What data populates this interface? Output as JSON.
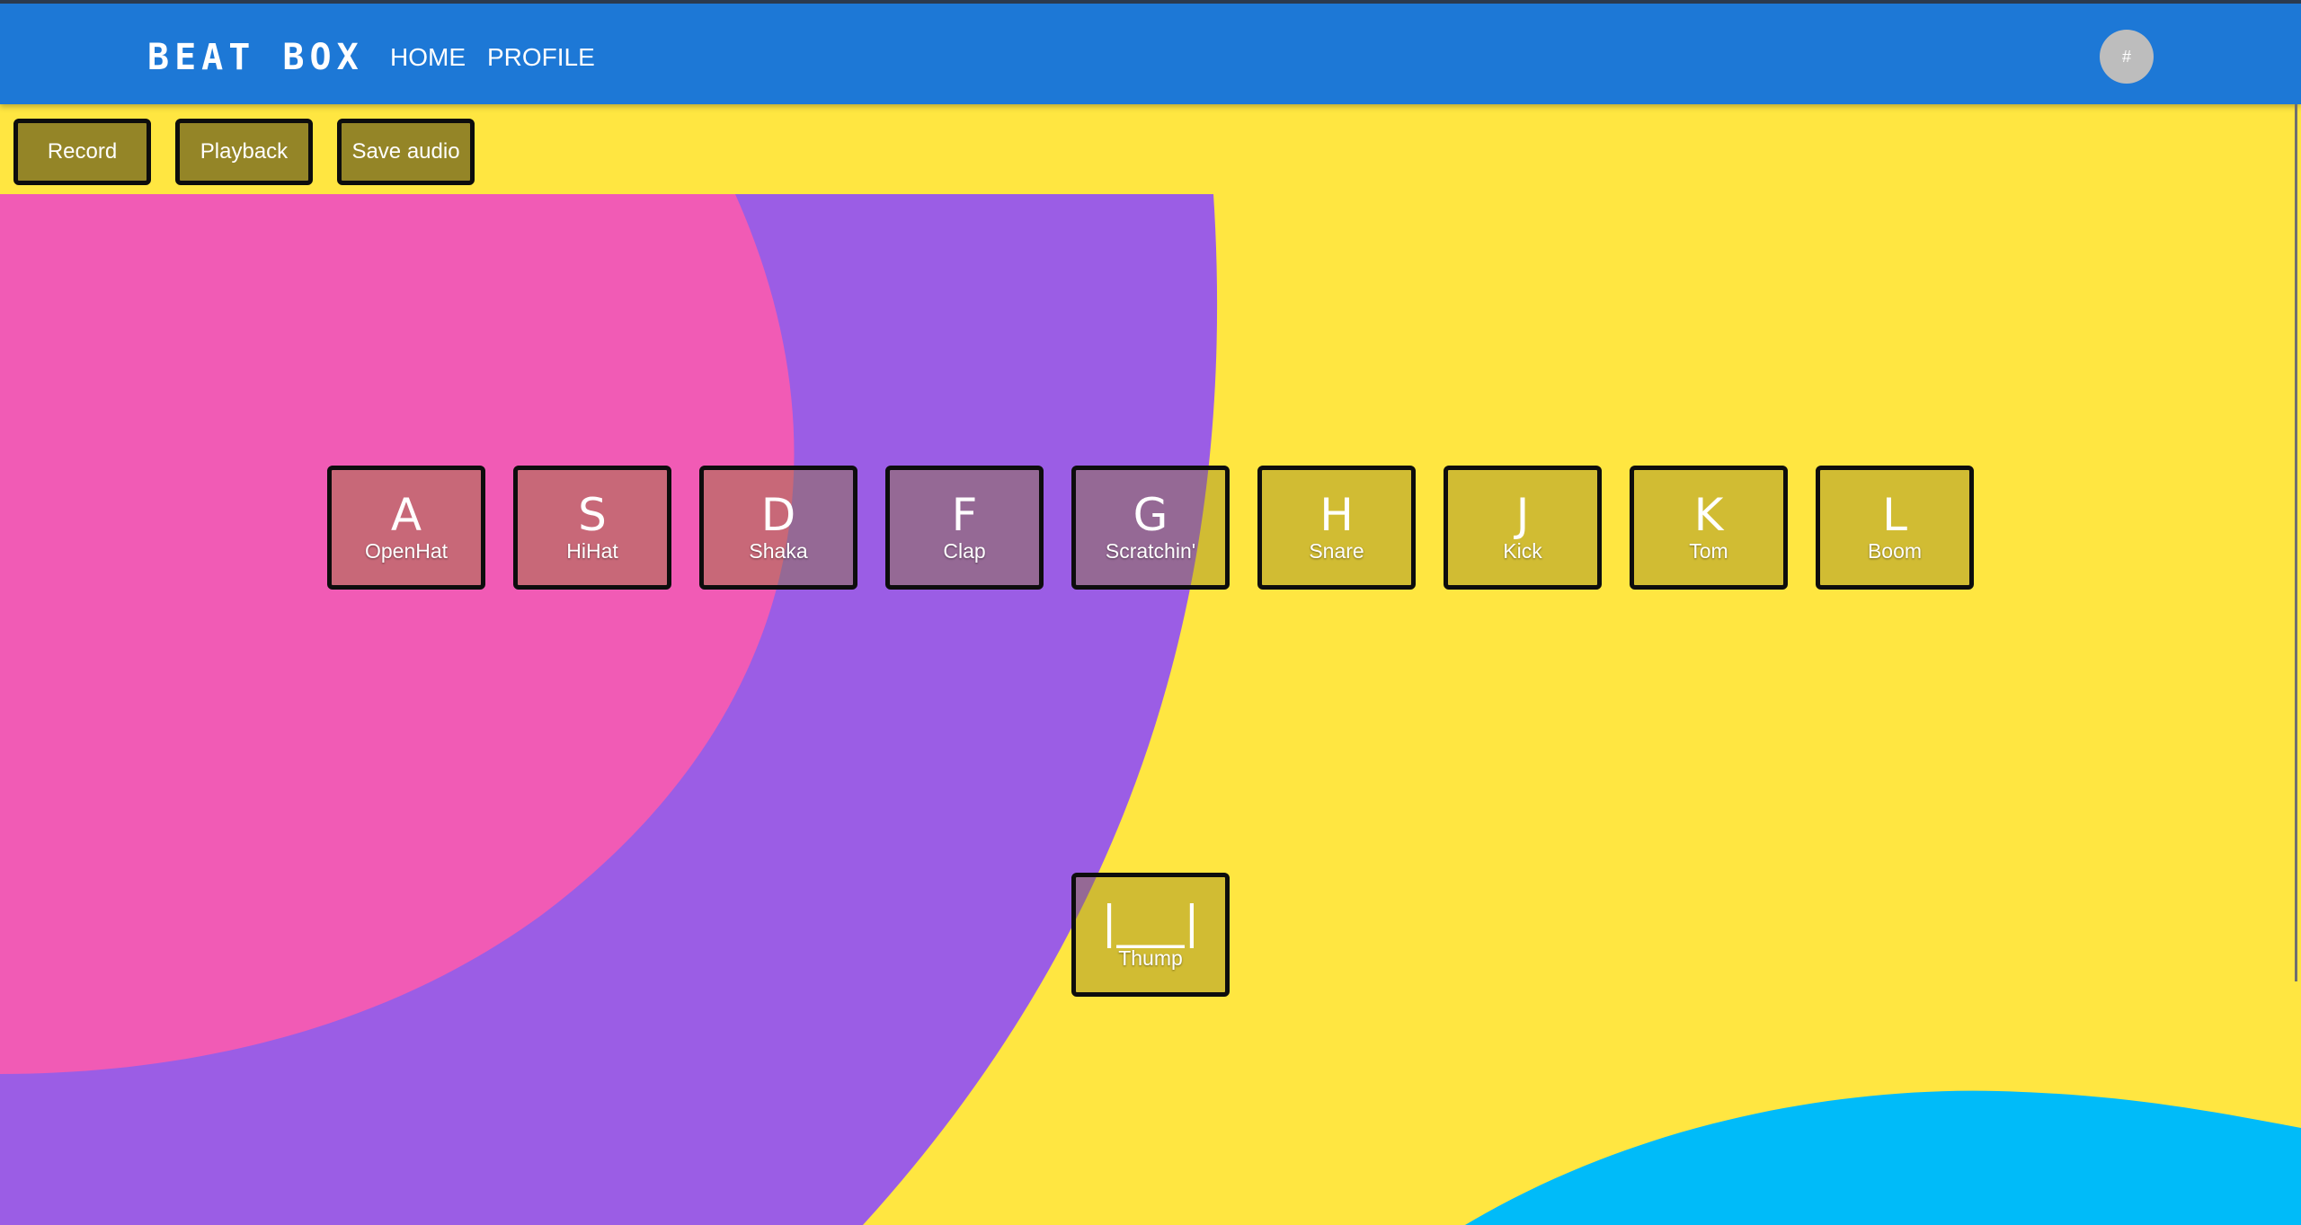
{
  "navbar": {
    "brand": "BEAT BOX",
    "links": [
      {
        "label": "HOME"
      },
      {
        "label": "PROFILE"
      }
    ],
    "avatar_text": "#"
  },
  "toolbar": {
    "record_label": "Record",
    "playback_label": "Playback",
    "save_label": "Save audio"
  },
  "drum_keys": [
    {
      "key": "A",
      "sound": "OpenHat"
    },
    {
      "key": "S",
      "sound": "HiHat"
    },
    {
      "key": "D",
      "sound": "Shaka"
    },
    {
      "key": "F",
      "sound": "Clap"
    },
    {
      "key": "G",
      "sound": "Scratchin'"
    },
    {
      "key": "H",
      "sound": "Snare"
    },
    {
      "key": "J",
      "sound": "Kick"
    },
    {
      "key": "K",
      "sound": "Tom"
    },
    {
      "key": "L",
      "sound": "Boom"
    }
  ],
  "space_key": {
    "key": "|___|",
    "sound": "Thump"
  },
  "colors": {
    "background_yellow": "#ffe641",
    "navbar_blue": "#1d78d6",
    "blob_pink": "#f15bb5",
    "blob_purple": "#9b5de5",
    "blob_cyan": "#00bbf9",
    "button_olive": "#948527"
  }
}
